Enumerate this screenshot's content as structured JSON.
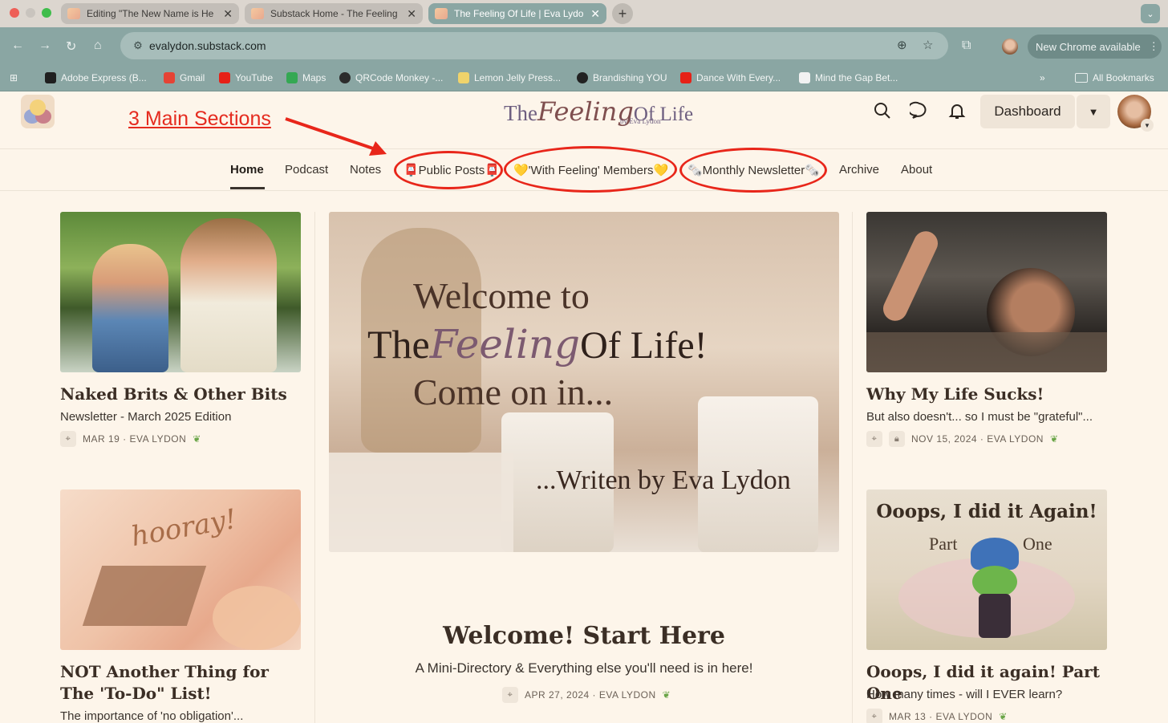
{
  "browser": {
    "tabs": [
      {
        "title": "Editing \"The New Name is He"
      },
      {
        "title": "Substack Home - The Feeling"
      },
      {
        "title": "The Feeling Of Life | Eva Lydo"
      }
    ],
    "url": "evalydon.substack.com",
    "update_label": "New Chrome available",
    "bookmarks": [
      {
        "label": "Adobe Express (B..."
      },
      {
        "label": "Gmail"
      },
      {
        "label": "YouTube"
      },
      {
        "label": "Maps"
      },
      {
        "label": "QRCode Monkey -..."
      },
      {
        "label": "Lemon Jelly Press..."
      },
      {
        "label": "Brandishing YOU"
      },
      {
        "label": "Dance With Every..."
      },
      {
        "label": "Mind the Gap Bet..."
      }
    ],
    "all_bookmarks": "All Bookmarks"
  },
  "site": {
    "brand_the": "The",
    "brand_feeling": "Feeling",
    "brand_of_life": "Of Life",
    "brand_sub": "by Eva Lydon",
    "dashboard_label": "Dashboard"
  },
  "annotation": "3 Main Sections",
  "nav": [
    {
      "label": "Home"
    },
    {
      "label": "Podcast"
    },
    {
      "label": "Notes"
    },
    {
      "label": "📮Public Posts📮"
    },
    {
      "label": "💛'With Feeling' Members💛"
    },
    {
      "label": "🗞️Monthly Newsletter🗞️"
    },
    {
      "label": "Archive"
    },
    {
      "label": "About"
    }
  ],
  "hero": {
    "line1": "Welcome to",
    "line2_the": "The",
    "line2_feeling": "Feeling",
    "line2_rest": "Of Life!",
    "line3": "Come on in...",
    "line4": "...Writen by Eva Lydon",
    "title": "Welcome! Start Here",
    "subtitle": "A Mini-Directory & Everything else you'll need is in here!",
    "meta": "APR 27, 2024 · EVA LYDON"
  },
  "posts": {
    "left1": {
      "title": "Naked Brits & Other Bits",
      "subtitle": "Newsletter - March 2025 Edition",
      "meta": "MAR 19 · EVA LYDON"
    },
    "left2": {
      "title": "NOT Another Thing for The 'To-Do\" List!",
      "subtitle": "The importance of 'no obligation'...",
      "image_text": "hooray!"
    },
    "right1": {
      "title": "Why My Life Sucks!",
      "subtitle": "But also doesn't... so I must be \"grateful\"...",
      "meta": "NOV 15, 2024 · EVA LYDON"
    },
    "right2": {
      "title": "Ooops, I did it again! Part One",
      "subtitle": "How many times - will I EVER learn?",
      "meta": "MAR 13 · EVA LYDON",
      "image_title": "Ooops, I did it Again!",
      "image_part": "Part",
      "image_one": "One"
    }
  },
  "colors": {
    "annotation_red": "#e8261a",
    "browser_teal": "#8aa6a3",
    "page_bg": "#fdf5ea"
  }
}
